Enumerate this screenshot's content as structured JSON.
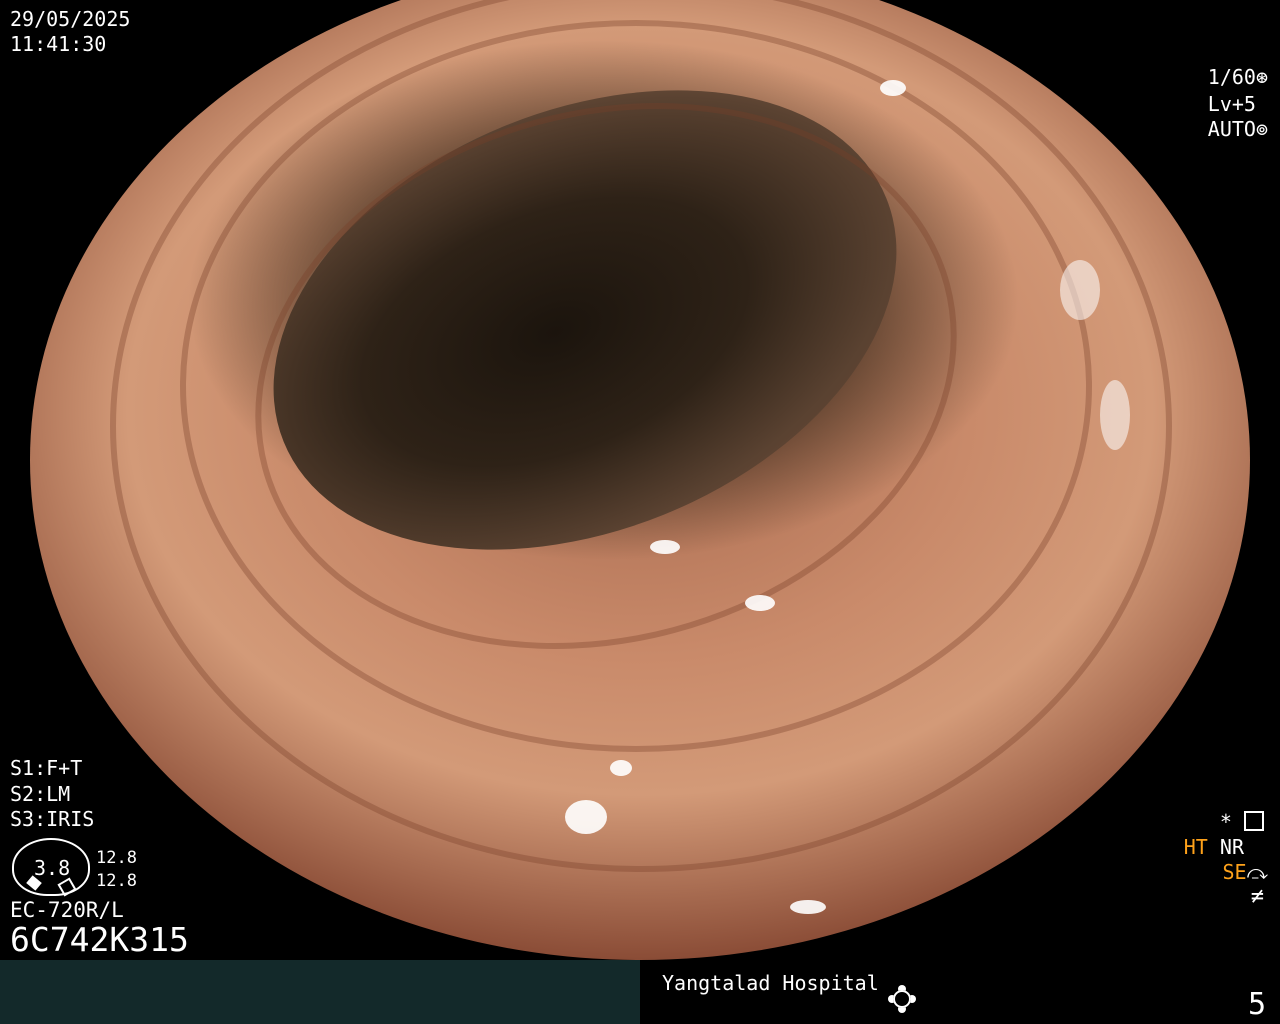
{
  "overlay": {
    "date": "29/05/2025",
    "time": "11:41:30",
    "shutter": "1/60",
    "level": "Lv+5",
    "mode": "AUTO",
    "settings": {
      "s1": "S1:F+T",
      "s2": "S2:LM",
      "s3": "S3:IRIS"
    },
    "gauge": {
      "value": "3.8",
      "top": "12.8",
      "bottom": "12.8"
    },
    "scope_model": "EC-720R/L",
    "serial": "6C742K315",
    "indicators": {
      "star": "*",
      "ht": "HT",
      "nr": "NR",
      "se": "SE"
    }
  },
  "bottom_bar": {
    "hospital": "Yangtalad Hospital",
    "frame_number": "5"
  }
}
